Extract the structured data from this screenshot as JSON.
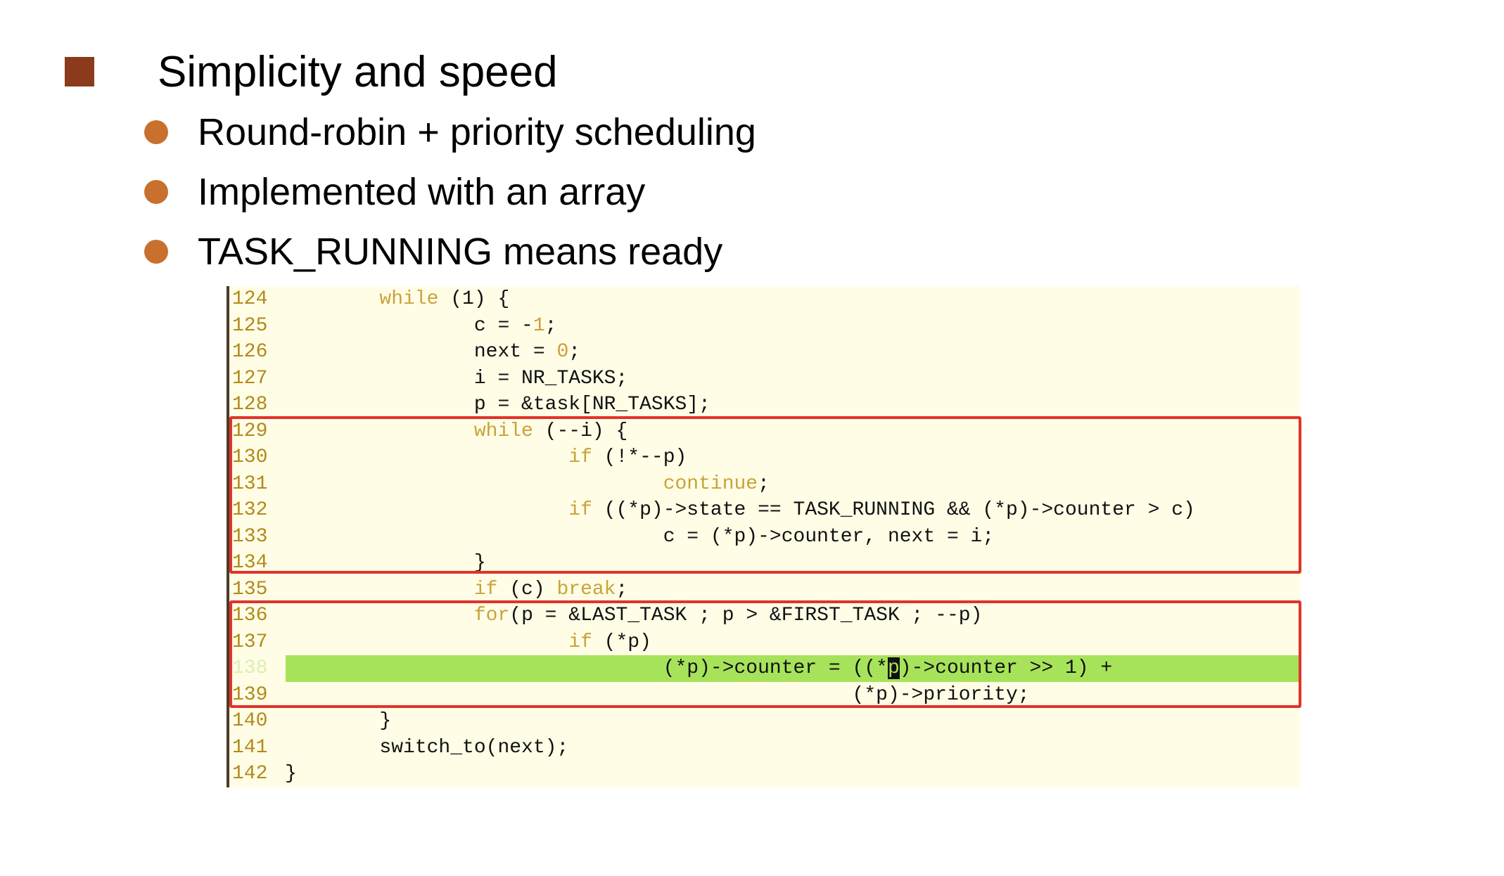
{
  "heading": "Simplicity and speed",
  "bullets": [
    "Round-robin + priority scheduling",
    "Implemented with an array",
    "TASK_RUNNING means ready"
  ],
  "code": {
    "lines": [
      {
        "num": "124",
        "segs": [
          {
            "t": "        "
          },
          {
            "t": "while",
            "c": "kw"
          },
          {
            "t": " (1) {"
          }
        ]
      },
      {
        "num": "125",
        "segs": [
          {
            "t": "                c = -"
          },
          {
            "t": "1",
            "c": "num"
          },
          {
            "t": ";"
          }
        ]
      },
      {
        "num": "126",
        "segs": [
          {
            "t": "                next = "
          },
          {
            "t": "0",
            "c": "num"
          },
          {
            "t": ";"
          }
        ]
      },
      {
        "num": "127",
        "segs": [
          {
            "t": "                i = NR_TASKS;"
          }
        ]
      },
      {
        "num": "128",
        "segs": [
          {
            "t": "                p = &task[NR_TASKS];"
          }
        ]
      },
      {
        "num": "129",
        "segs": [
          {
            "t": "                "
          },
          {
            "t": "while",
            "c": "kw"
          },
          {
            "t": " (--i) {"
          }
        ]
      },
      {
        "num": "130",
        "segs": [
          {
            "t": "                        "
          },
          {
            "t": "if",
            "c": "kw"
          },
          {
            "t": " (!*--p)"
          }
        ]
      },
      {
        "num": "131",
        "segs": [
          {
            "t": "                                "
          },
          {
            "t": "continue",
            "c": "kw"
          },
          {
            "t": ";"
          }
        ]
      },
      {
        "num": "132",
        "segs": [
          {
            "t": "                        "
          },
          {
            "t": "if",
            "c": "kw"
          },
          {
            "t": " ((*p)->state == TASK_RUNNING && (*p)->counter > c)"
          }
        ]
      },
      {
        "num": "133",
        "segs": [
          {
            "t": "                                c = (*p)->counter, next = i;"
          }
        ]
      },
      {
        "num": "134",
        "segs": [
          {
            "t": "                }"
          }
        ]
      },
      {
        "num": "135",
        "segs": [
          {
            "t": "                "
          },
          {
            "t": "if",
            "c": "kw"
          },
          {
            "t": " (c) "
          },
          {
            "t": "break",
            "c": "kw"
          },
          {
            "t": ";"
          }
        ]
      },
      {
        "num": "136",
        "segs": [
          {
            "t": "                "
          },
          {
            "t": "for",
            "c": "kw"
          },
          {
            "t": "(p = &LAST_TASK ; p > &FIRST_TASK ; --p)"
          }
        ]
      },
      {
        "num": "137",
        "segs": [
          {
            "t": "                        "
          },
          {
            "t": "if",
            "c": "kw"
          },
          {
            "t": " (*p)"
          }
        ]
      },
      {
        "num": "138",
        "highlight": true,
        "segs": [
          {
            "t": "                                (*p)->counter = ((*"
          },
          {
            "t": "p",
            "c": "cursor"
          },
          {
            "t": ")->counter >> 1) +"
          }
        ]
      },
      {
        "num": "139",
        "segs": [
          {
            "t": "                                                (*p)->priority;"
          }
        ]
      },
      {
        "num": "140",
        "segs": [
          {
            "t": "        }"
          }
        ]
      },
      {
        "num": "141",
        "segs": [
          {
            "t": "        switch_to(next);"
          }
        ]
      },
      {
        "num": "142",
        "segs": [
          {
            "t": "}"
          }
        ]
      }
    ],
    "highlight_color": "#a7e35a",
    "box_color": "#e0342a"
  },
  "colors": {
    "square_bullet": "#8b3a1c",
    "dot_bullet": "#c8702e",
    "code_bg": "#fffde6",
    "keyword": "#c9a33a"
  }
}
